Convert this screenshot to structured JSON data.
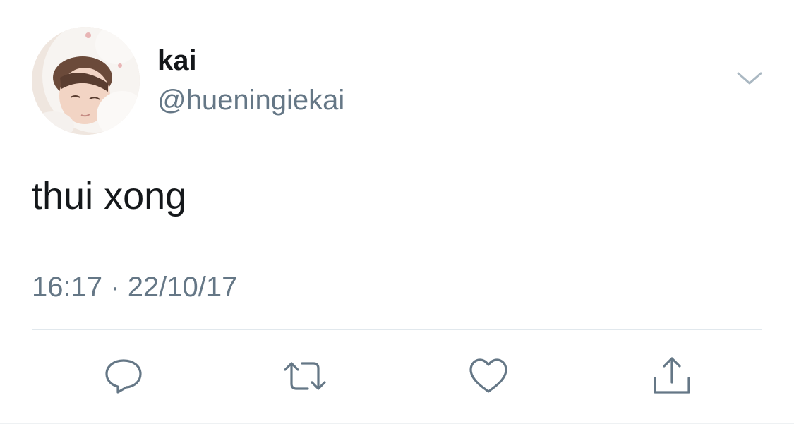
{
  "tweet": {
    "display_name": "kai",
    "handle": "@hueningiekai",
    "text": "thui xong",
    "time": "16:17",
    "separator": "·",
    "date": "22/10/17"
  },
  "icons": {
    "menu": "chevron-down-icon",
    "reply": "reply-icon",
    "retweet": "retweet-icon",
    "like": "heart-icon",
    "share": "share-icon"
  },
  "colors": {
    "text_primary": "#14171a",
    "text_secondary": "#657786",
    "icon": "#657786",
    "divider": "#e1e8ed"
  }
}
